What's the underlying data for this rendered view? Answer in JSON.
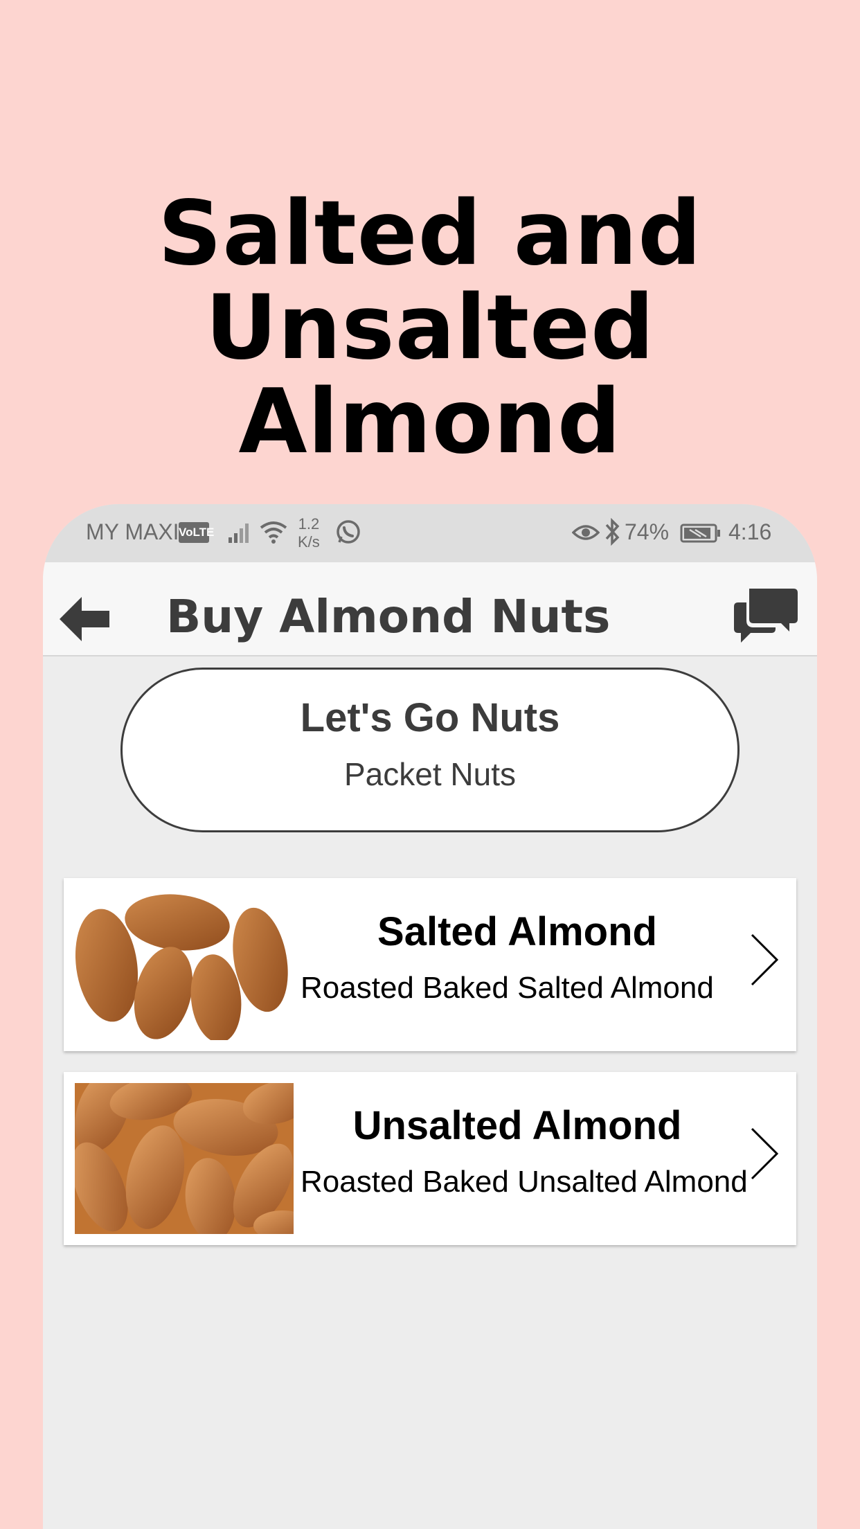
{
  "promo": {
    "title_line1": "Salted and",
    "title_line2": "Unsalted Almond"
  },
  "status_bar": {
    "carrier": "MY MAXIS",
    "volte": "VoLTE",
    "speed_value": "1.2",
    "speed_unit": "K/s",
    "battery": "74%",
    "time": "4:16"
  },
  "app_bar": {
    "title": "Buy Almond Nuts",
    "back_icon": "back-arrow-icon",
    "chat_icon": "chat-bubbles-icon"
  },
  "store": {
    "name": "Let's Go Nuts",
    "subtitle": "Packet Nuts"
  },
  "products": [
    {
      "title": "Salted Almond",
      "description": "Roasted Baked Salted Almond"
    },
    {
      "title": "Unsalted Almond",
      "description": "Roasted Baked Unsalted Almond"
    }
  ],
  "colors": {
    "background": "#fdd5d0",
    "phone_body": "#ededed",
    "status_bar": "#dedede",
    "almond": "#b5652a"
  }
}
